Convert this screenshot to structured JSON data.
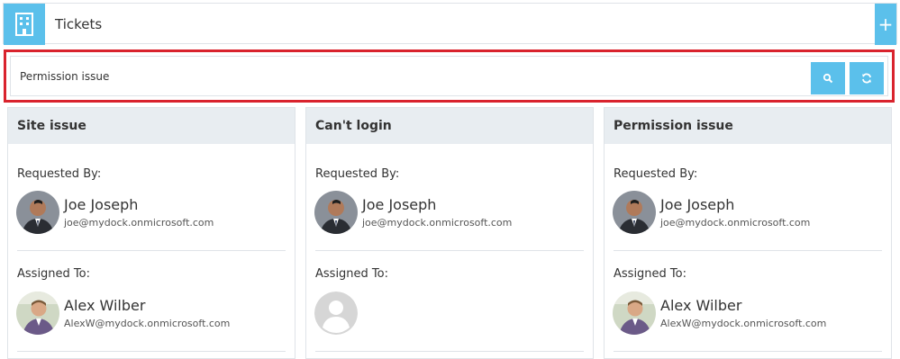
{
  "header": {
    "title": "Tickets",
    "add_label": "+"
  },
  "filter": {
    "value": "Permission issue",
    "search_icon": "search-icon",
    "refresh_icon": "refresh-icon"
  },
  "labels": {
    "requested_by": "Requested By:",
    "assigned_to": "Assigned To:"
  },
  "cards": [
    {
      "title": "Site issue",
      "requester": {
        "name": "Joe Joseph",
        "email": "joe@mydock.onmicrosoft.com"
      },
      "assignee": {
        "name": "Alex Wilber",
        "email": "AlexW@mydock.onmicrosoft.com"
      }
    },
    {
      "title": "Can't login",
      "requester": {
        "name": "Joe Joseph",
        "email": "joe@mydock.onmicrosoft.com"
      },
      "assignee": {
        "name": "",
        "email": ""
      }
    },
    {
      "title": "Permission issue",
      "requester": {
        "name": "Joe Joseph",
        "email": "joe@mydock.onmicrosoft.com"
      },
      "assignee": {
        "name": "Alex Wilber",
        "email": "AlexW@mydock.onmicrosoft.com"
      }
    }
  ],
  "colors": {
    "accent": "#5bc0eb",
    "highlight_border": "#d9232d",
    "card_header": "#e8edf1"
  }
}
